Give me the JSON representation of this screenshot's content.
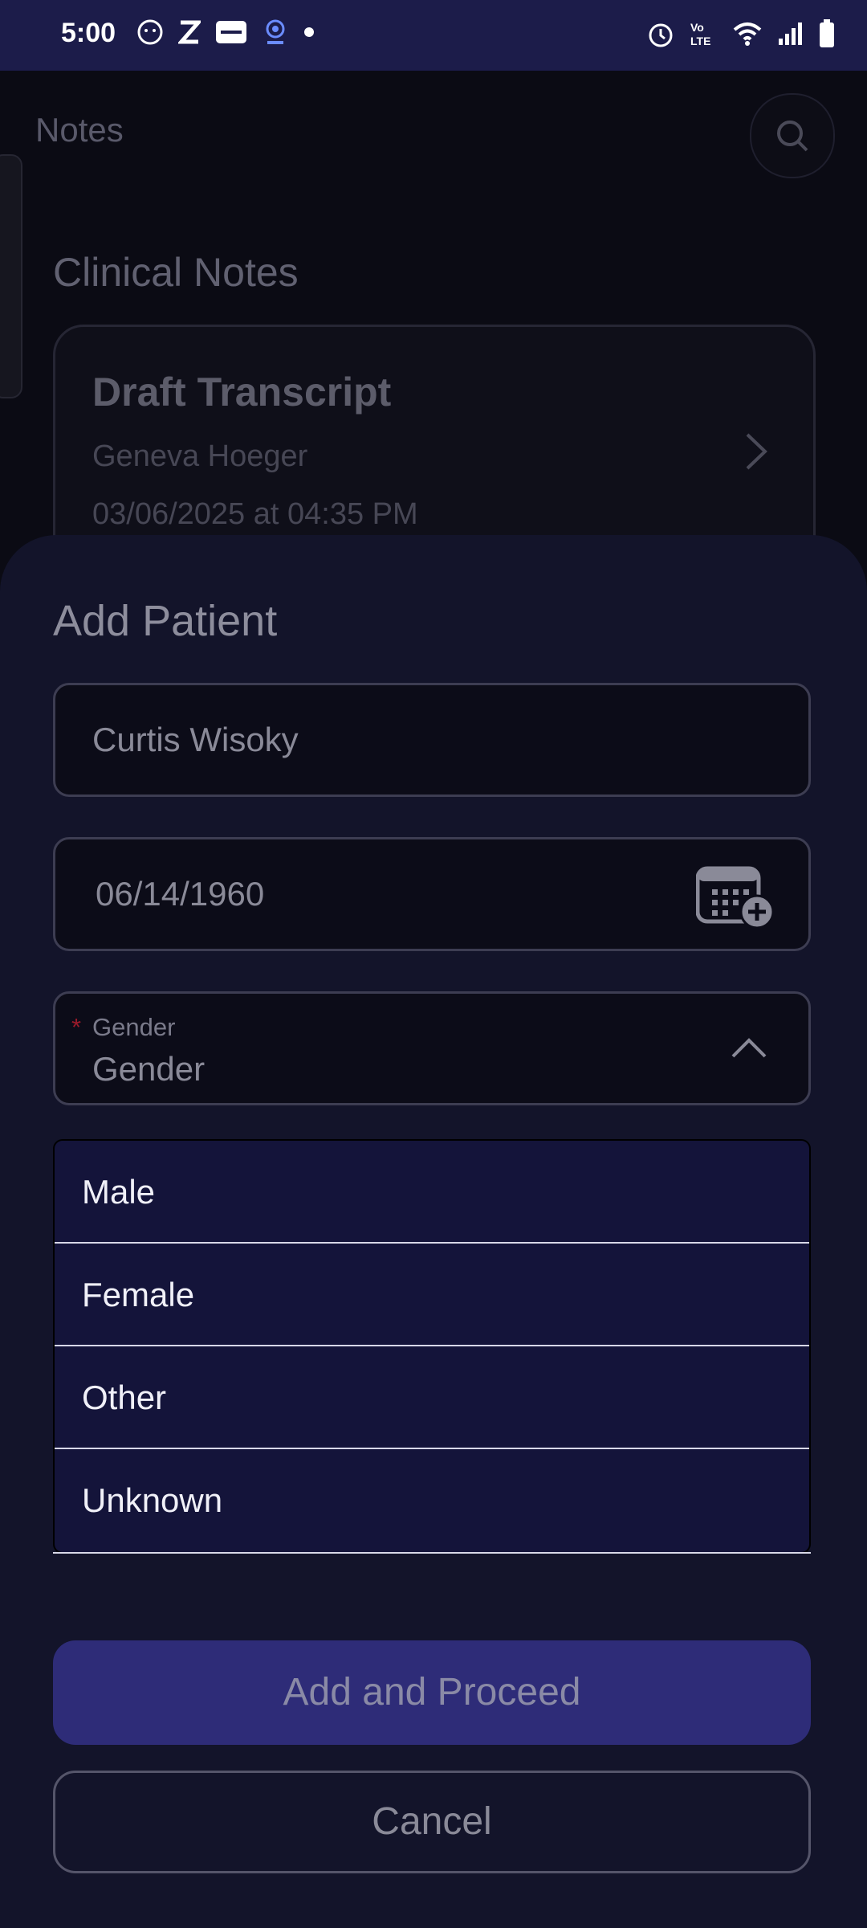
{
  "status_bar": {
    "time": "5:00",
    "left_icons": [
      "face-icon",
      "z-app-icon",
      "vivo-icon",
      "webcam-icon",
      "dot-icon"
    ],
    "right_icons": [
      "alarm-icon",
      "volte-icon",
      "wifi-icon",
      "signal-icon",
      "battery-icon"
    ],
    "volte_label": "Vo LTE"
  },
  "background": {
    "title": "Notes",
    "section_title": "Clinical Notes",
    "card": {
      "title": "Draft Transcript",
      "patient": "Geneva Hoeger",
      "date": "03/06/2025 at 04:35 PM"
    }
  },
  "sheet": {
    "title": "Add Patient",
    "name_value": "Curtis Wisoky",
    "dob_value": "06/14/1960",
    "gender": {
      "required_mark": "*",
      "label": "Gender",
      "value": "Gender",
      "options": [
        "Male",
        "Female",
        "Other",
        "Unknown"
      ]
    },
    "primary_button": "Add and Proceed",
    "cancel_button": "Cancel"
  },
  "colors": {
    "status_bar": "#1c1c4a",
    "sheet_bg": "#13142a",
    "primary_button": "#2e2c78",
    "required": "#9a1a2a"
  }
}
